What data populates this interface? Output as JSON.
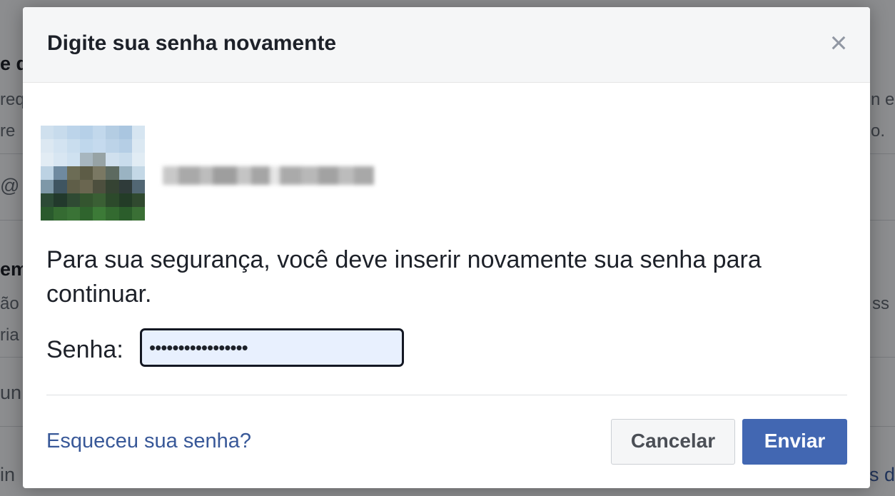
{
  "background": {
    "fragments": [
      "e d",
      "req",
      "re",
      "@",
      "em",
      "ão",
      "ria",
      "un",
      "in",
      "n e",
      "o.",
      "ss",
      "s d"
    ]
  },
  "dialog": {
    "title": "Digite sua senha novamente",
    "close_icon": "×",
    "user": {
      "avatar_icon": "profile-photo",
      "name_blurred": true
    },
    "message": "Para sua segurança, você deve inserir novamente sua senha para continuar.",
    "password": {
      "label": "Senha:",
      "value": "•••••••••••••••••"
    },
    "forgot_link": "Esqueceu sua senha?",
    "cancel_label": "Cancelar",
    "send_label": "Enviar"
  },
  "colors": {
    "primary": "#4267b2",
    "link": "#385898",
    "header_bg": "#f5f6f7",
    "input_bg": "#e8f0fe"
  }
}
